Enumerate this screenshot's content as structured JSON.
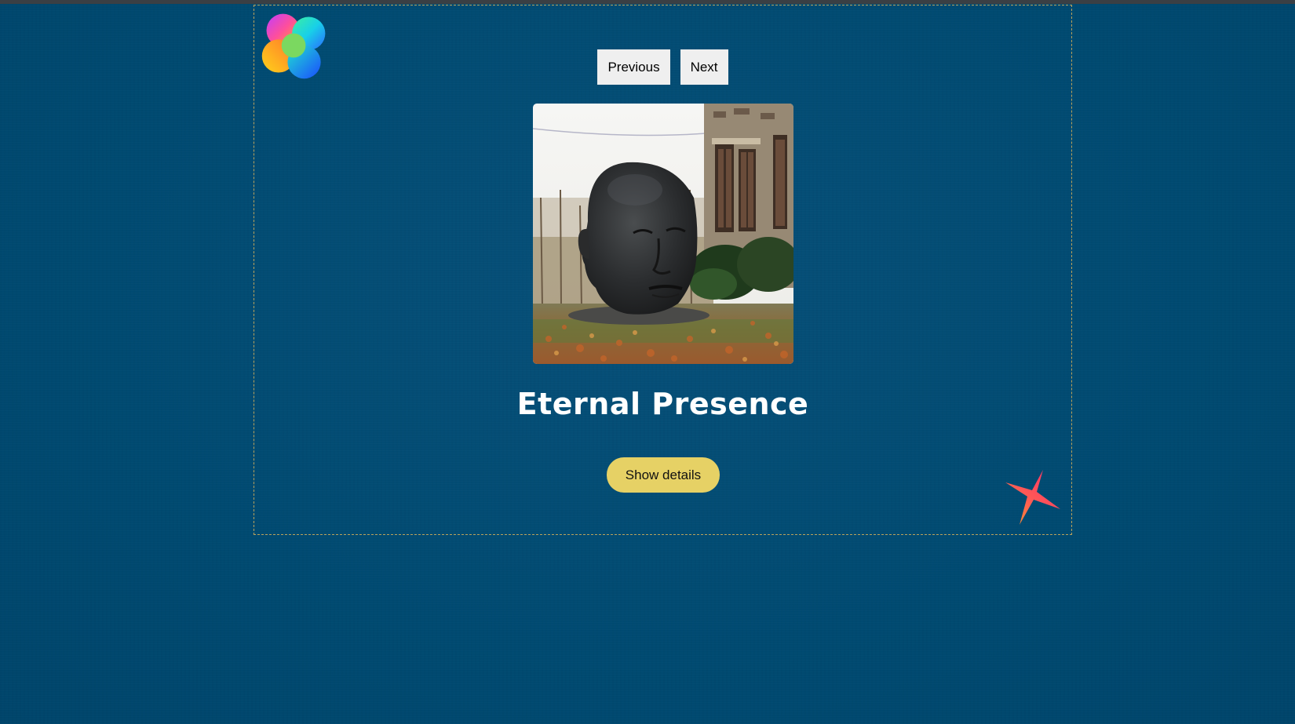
{
  "nav": {
    "previous_label": "Previous",
    "next_label": "Next"
  },
  "artwork": {
    "title": "Eternal Presence"
  },
  "actions": {
    "details_label": "Show details"
  },
  "decorations": {
    "logo_icon": "flower-logo-icon",
    "star_icon": "four-point-star-icon"
  },
  "colors": {
    "background": "#004a71",
    "details_button": "#e6d165",
    "nav_button": "#efefef",
    "frame_border": "#b9a25a"
  }
}
